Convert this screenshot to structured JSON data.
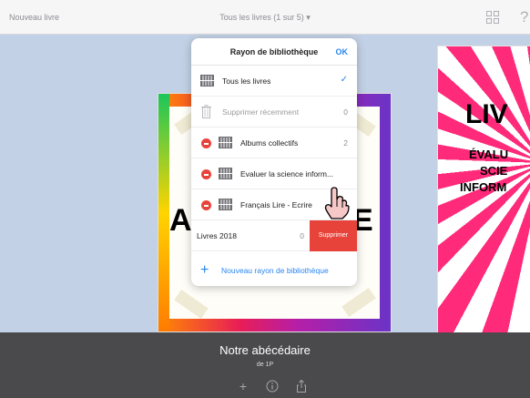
{
  "topbar": {
    "new_book": "Nouveau livre",
    "all_books": "Tous les livres (1 sur 5) ▾",
    "help": "?"
  },
  "popover": {
    "title": "Rayon de bibliothèque",
    "ok": "OK",
    "rows": [
      {
        "label": "Tous les livres",
        "selected": true
      },
      {
        "label": "Supprimer récemment",
        "count": "0"
      },
      {
        "label": "Albums collectifs",
        "count": "2"
      },
      {
        "label": "Evaluer la science inform..."
      },
      {
        "label": "Français Lire - Ecrire"
      }
    ],
    "swipe_row": {
      "label": "Livres 2018",
      "count": "0",
      "delete_label": "Supprimer"
    },
    "new_shelf": "Nouveau rayon de bibliothèque"
  },
  "cover_center": {
    "letter_left": "A",
    "letter_right": "E"
  },
  "cover_right": {
    "title": "LIV",
    "subtitle_lines": [
      "ÉVALU",
      "SCIE",
      "INFORM"
    ]
  },
  "bottom": {
    "title": "Notre abécédaire",
    "subtitle": "de 1P"
  },
  "colors": {
    "accent": "#2a84f0",
    "delete": "#e8433a",
    "bottom_bar": "#4a4a4d"
  }
}
